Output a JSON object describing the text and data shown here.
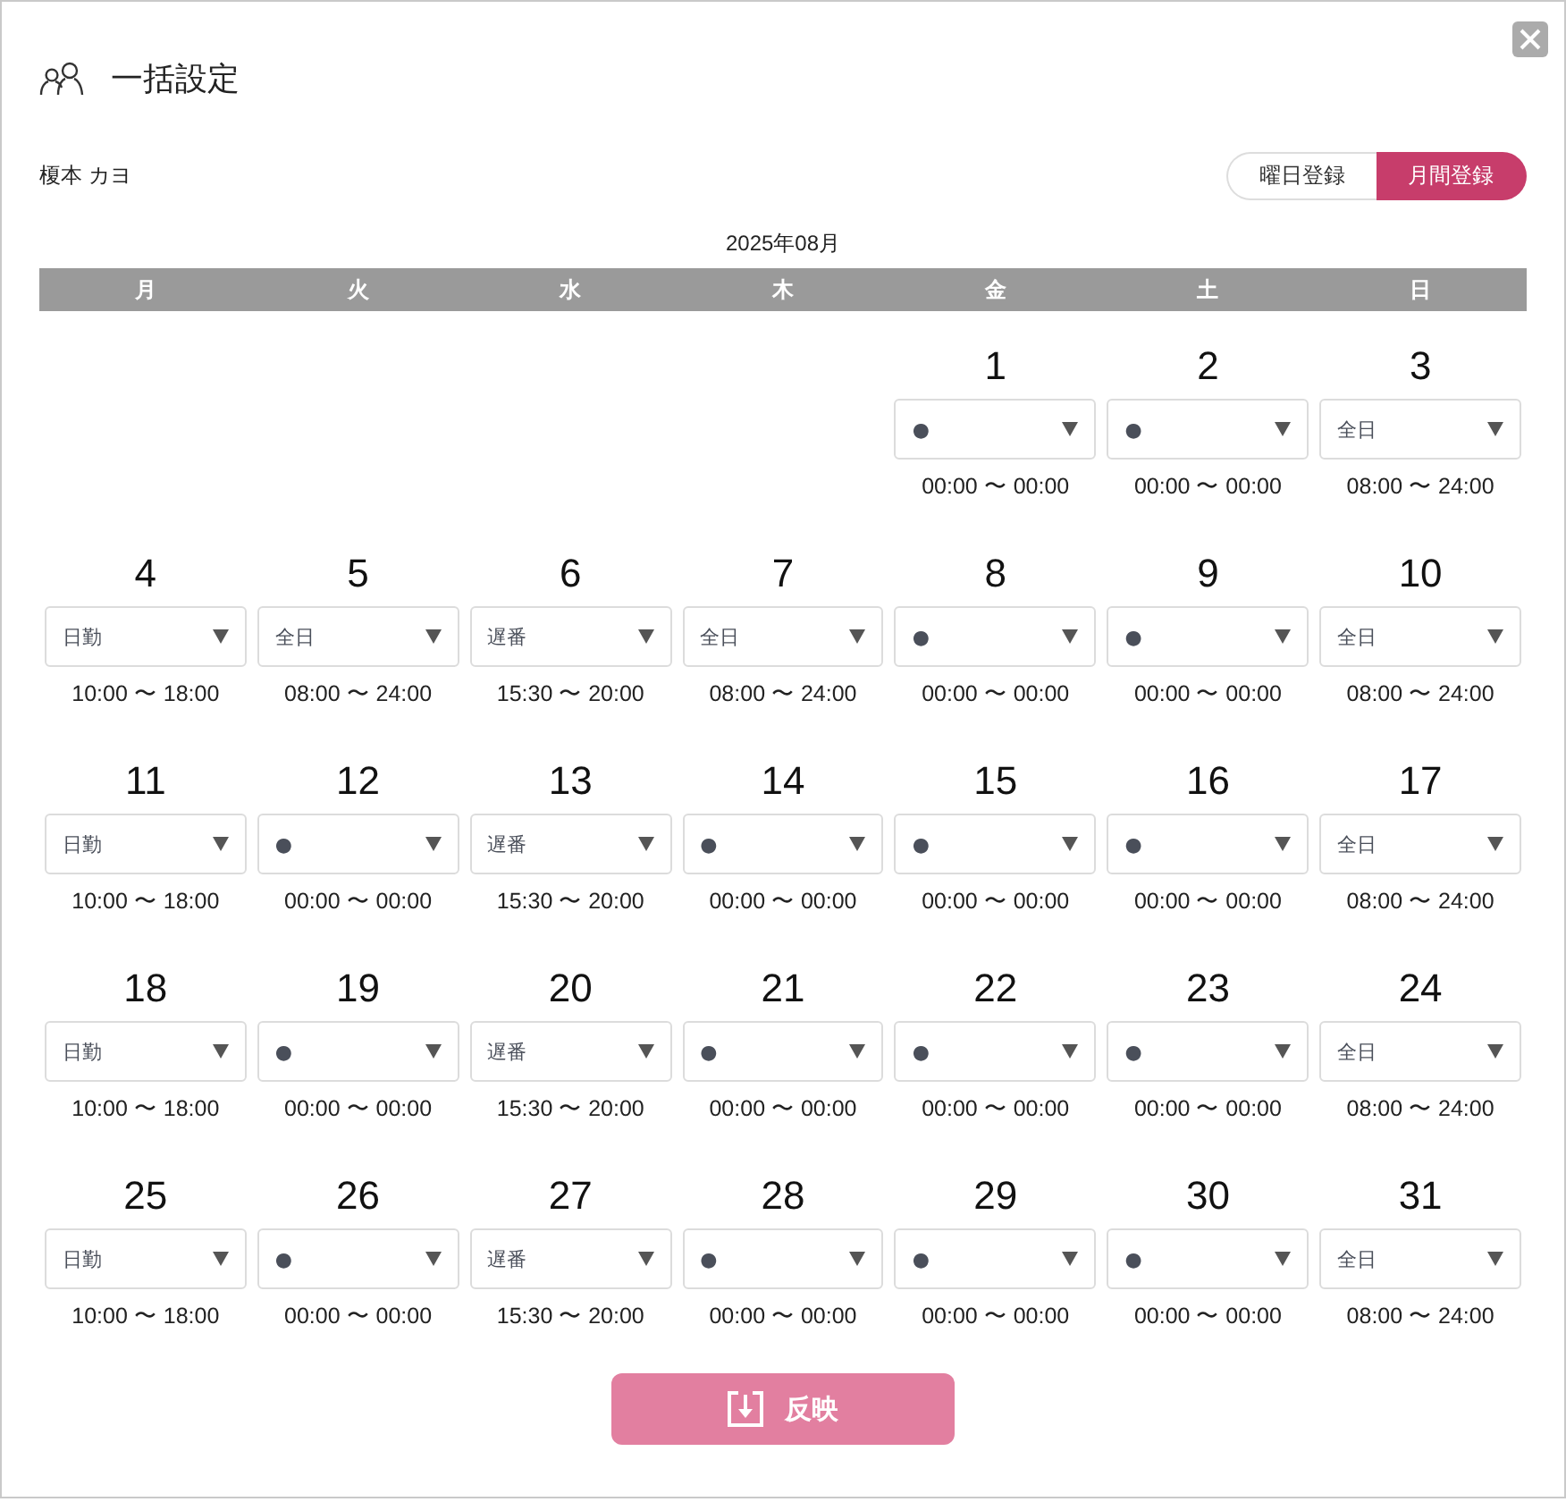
{
  "dialog": {
    "title": "一括設定"
  },
  "staff_name": "榎本 カヨ",
  "mode_tabs": [
    {
      "label": "曜日登録",
      "selected": false
    },
    {
      "label": "月間登録",
      "selected": true
    }
  ],
  "month": "2025年08月",
  "weekdays": [
    "月",
    "火",
    "水",
    "木",
    "金",
    "土",
    "日"
  ],
  "weeks": [
    {
      "days": [
        {
          "date": "1",
          "shift": "●",
          "time": "00:00 〜 00:00"
        },
        {
          "date": "2",
          "shift": "●",
          "time": "00:00 〜 00:00"
        },
        {
          "date": "3",
          "shift": "全日",
          "time": "08:00 〜 24:00"
        }
      ]
    },
    {
      "days": [
        {
          "date": "4",
          "shift": "日勤",
          "time": "10:00 〜 18:00"
        },
        {
          "date": "5",
          "shift": "全日",
          "time": "08:00 〜 24:00"
        },
        {
          "date": "6",
          "shift": "遅番",
          "time": "15:30 〜 20:00"
        },
        {
          "date": "7",
          "shift": "全日",
          "time": "08:00 〜 24:00"
        },
        {
          "date": "8",
          "shift": "●",
          "time": "00:00 〜 00:00"
        },
        {
          "date": "9",
          "shift": "●",
          "time": "00:00 〜 00:00"
        },
        {
          "date": "10",
          "shift": "全日",
          "time": "08:00 〜 24:00"
        }
      ]
    },
    {
      "days": [
        {
          "date": "11",
          "shift": "日勤",
          "time": "10:00 〜 18:00"
        },
        {
          "date": "12",
          "shift": "●",
          "time": "00:00 〜 00:00"
        },
        {
          "date": "13",
          "shift": "遅番",
          "time": "15:30 〜 20:00"
        },
        {
          "date": "14",
          "shift": "●",
          "time": "00:00 〜 00:00"
        },
        {
          "date": "15",
          "shift": "●",
          "time": "00:00 〜 00:00"
        },
        {
          "date": "16",
          "shift": "●",
          "time": "00:00 〜 00:00"
        },
        {
          "date": "17",
          "shift": "全日",
          "time": "08:00 〜 24:00"
        }
      ]
    },
    {
      "days": [
        {
          "date": "18",
          "shift": "日勤",
          "time": "10:00 〜 18:00"
        },
        {
          "date": "19",
          "shift": "●",
          "time": "00:00 〜 00:00"
        },
        {
          "date": "20",
          "shift": "遅番",
          "time": "15:30 〜 20:00"
        },
        {
          "date": "21",
          "shift": "●",
          "time": "00:00 〜 00:00"
        },
        {
          "date": "22",
          "shift": "●",
          "time": "00:00 〜 00:00"
        },
        {
          "date": "23",
          "shift": "●",
          "time": "00:00 〜 00:00"
        },
        {
          "date": "24",
          "shift": "全日",
          "time": "08:00 〜 24:00"
        }
      ]
    },
    {
      "days": [
        {
          "date": "25",
          "shift": "日勤",
          "time": "10:00 〜 18:00"
        },
        {
          "date": "26",
          "shift": "●",
          "time": "00:00 〜 00:00"
        },
        {
          "date": "27",
          "shift": "遅番",
          "time": "15:30 〜 20:00"
        },
        {
          "date": "28",
          "shift": "●",
          "time": "00:00 〜 00:00"
        },
        {
          "date": "29",
          "shift": "●",
          "time": "00:00 〜 00:00"
        },
        {
          "date": "30",
          "shift": "●",
          "time": "00:00 〜 00:00"
        },
        {
          "date": "31",
          "shift": "全日",
          "time": "08:00 〜 24:00"
        }
      ]
    }
  ],
  "apply_button": {
    "label": "反映"
  }
}
